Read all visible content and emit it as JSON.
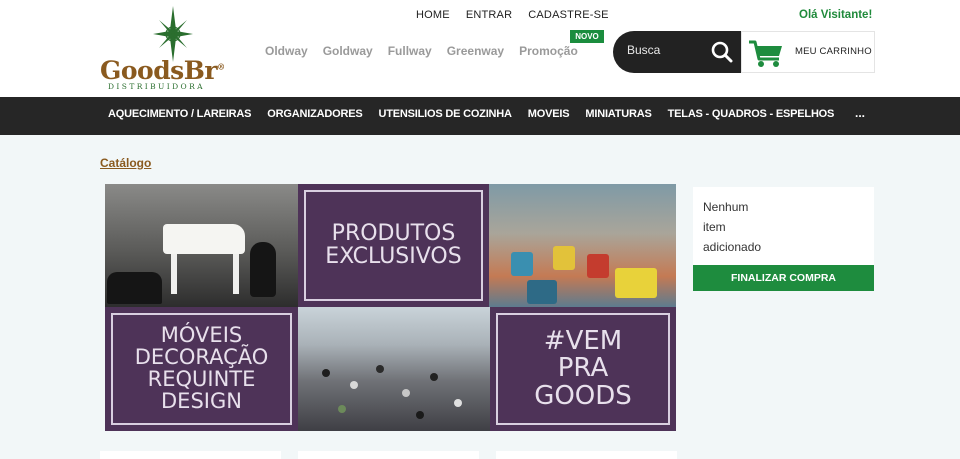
{
  "logo": {
    "name": "GoodsBr",
    "registered": "®",
    "subtitle": "DISTRIBUIDORA"
  },
  "top_nav": [
    "HOME",
    "ENTRAR",
    "CADASTRE-SE"
  ],
  "greeting": "Olá Visitante!",
  "brands": [
    "Oldway",
    "Goldway",
    "Fullway",
    "Greenway",
    "Promoção"
  ],
  "promo_badge": "NOVO",
  "search": {
    "placeholder": "Busca",
    "icon": "search-icon"
  },
  "cart": {
    "label": "MEU CARRINHO",
    "icon": "cart-icon"
  },
  "categories": [
    "AQUECIMENTO / LAREIRAS",
    "ORGANIZADORES",
    "UTENSILIOS DE COZINHA",
    "MOVEIS",
    "MINIATURAS",
    "TELAS - QUADROS - ESPELHOS"
  ],
  "categories_more": "...",
  "breadcrumb": "Catálogo",
  "banner": {
    "tile_1": [
      "PRODUTOS",
      "EXCLUSIVOS"
    ],
    "tile_2": [
      "MÓVEIS",
      "DECORAÇÃO",
      "REQUINTE",
      "DESIGN"
    ],
    "tile_3": [
      "#VEM",
      "PRA",
      "GOODS"
    ]
  },
  "cart_sidebar": {
    "empty_text": "Nenhum item adicionado",
    "checkout_button": "FINALIZAR COMPRA"
  },
  "colors": {
    "brand_green": "#1e8c3e",
    "brand_brown": "#8a5a1f",
    "banner_purple": "#4e3358",
    "category_bar": "#262626"
  }
}
